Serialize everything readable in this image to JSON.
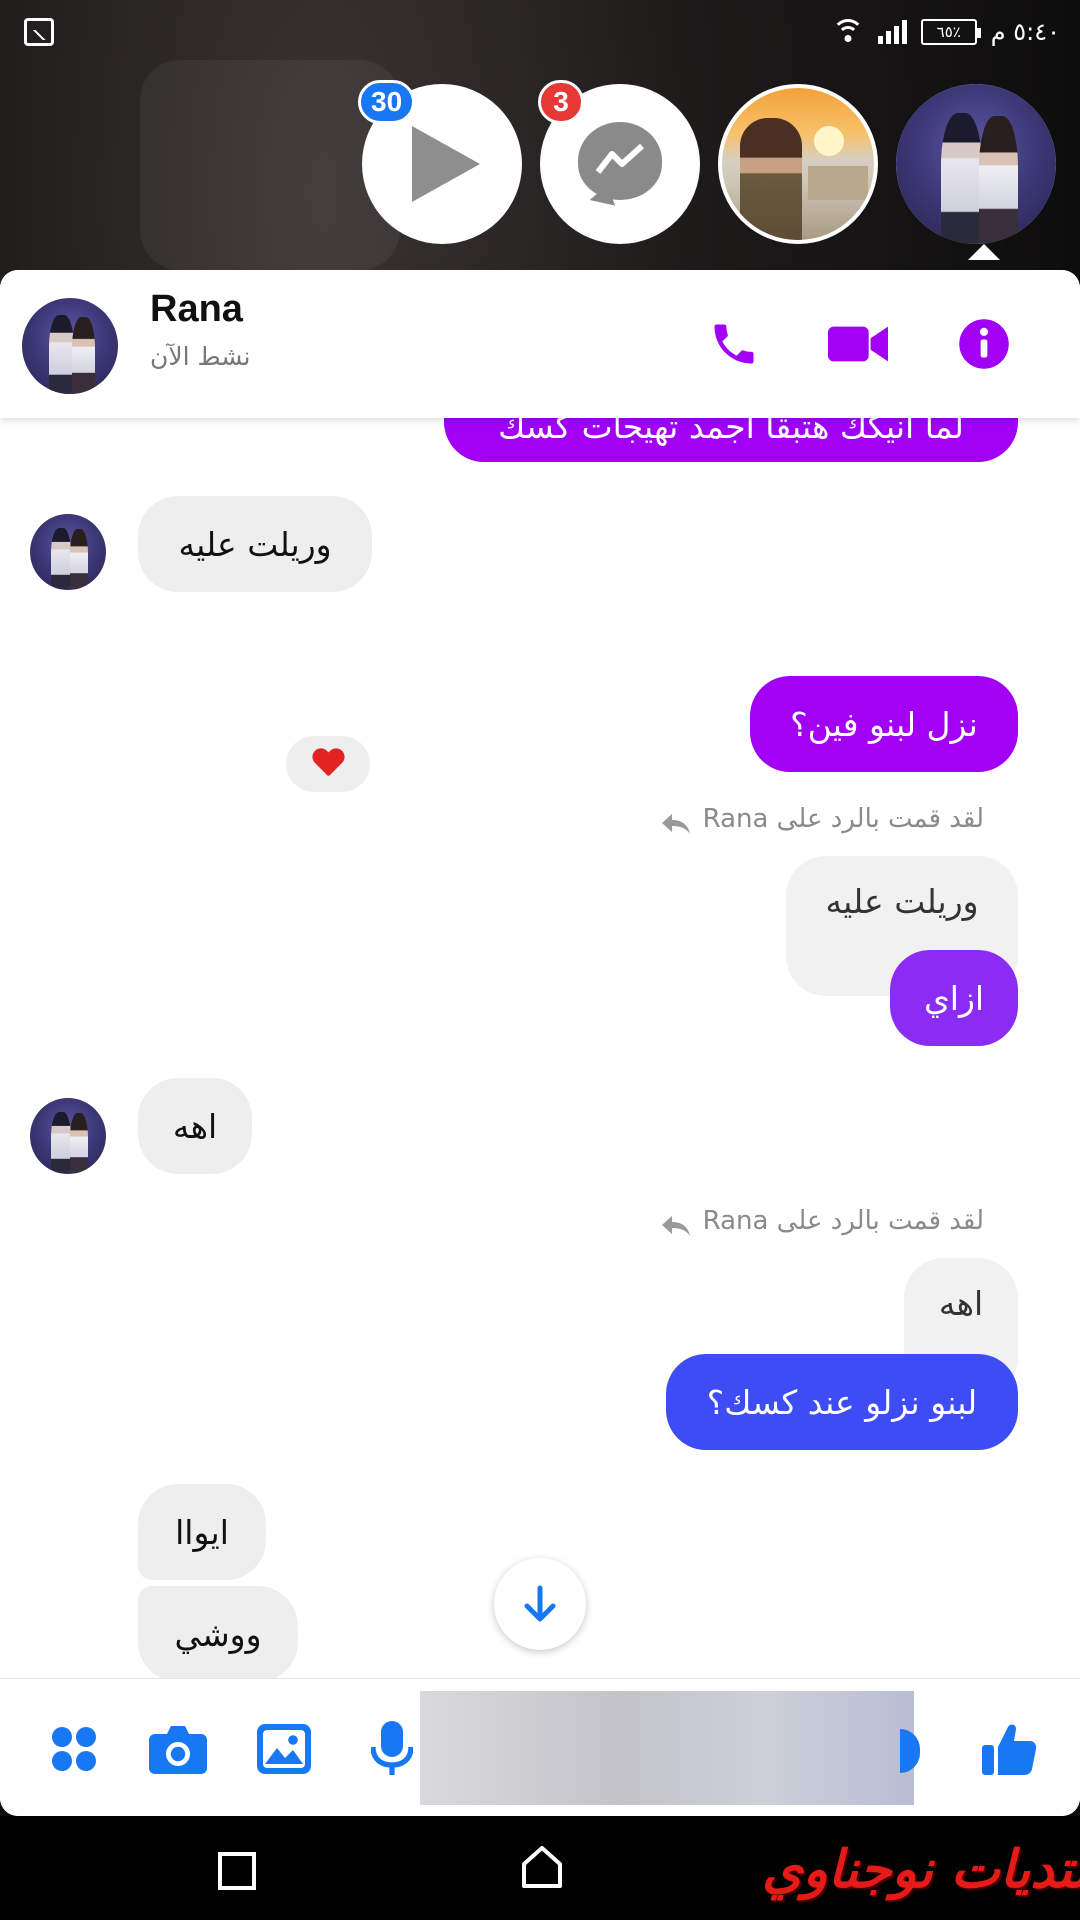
{
  "status_bar": {
    "time": "٥:٤٠ م",
    "battery": "٦٥٪"
  },
  "chat_heads": {
    "videos_badge": "30",
    "messenger_badge": "3"
  },
  "header": {
    "name": "Rana",
    "status": "نشط الآن"
  },
  "messages": {
    "partial_top": "لما انيكك هتبقا اجمد تهيجات كسك",
    "incoming_1": "وريلت عليه",
    "reaction_1": "❤",
    "outgoing_1": "نزل لبنو فين؟",
    "reply_label_1": "لقد قمت بالرد على Rana",
    "quoted_1": "وريلت عليه",
    "outgoing_2": "ازاي",
    "incoming_2": "اهه",
    "reply_label_2": "لقد قمت بالرد على Rana",
    "quoted_2": "اهه",
    "outgoing_3": "لبنو نزلو عند كسك؟",
    "incoming_3": "ايواا",
    "incoming_4": "ووشي"
  },
  "watermark": "منتديات نوجناوي",
  "colors": {
    "accent_purple": "#a100f5",
    "accent_blue": "#1877f2",
    "bubble_violet": "#8b2cf5",
    "bubble_blue": "#3d4cf5",
    "badge_red": "#e53935"
  },
  "icons": [
    "gallery-icon",
    "wifi-icon",
    "signal-icon",
    "battery-icon",
    "play-icon",
    "messenger-icon",
    "phone-icon",
    "video-call-icon",
    "info-icon",
    "reply-arrow-icon",
    "heart-icon",
    "arrow-down-icon",
    "more-icon",
    "camera-icon",
    "image-icon",
    "mic-icon",
    "like-icon",
    "recent-apps-icon",
    "home-icon"
  ]
}
